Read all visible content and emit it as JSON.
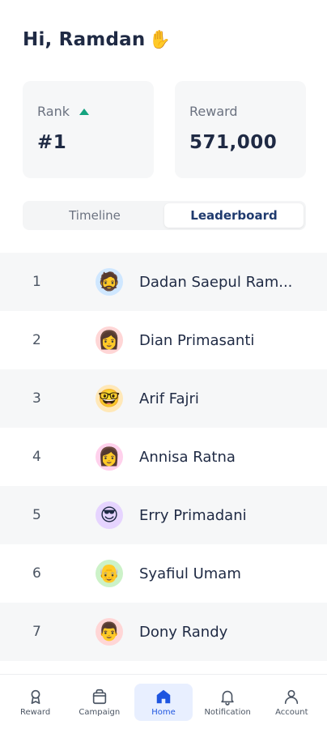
{
  "greeting": {
    "text": "Hi, Ramdan",
    "emoji": "✋"
  },
  "stats": {
    "rank": {
      "label": "Rank",
      "value": "#1",
      "trend": "up",
      "trend_color": "#14a37f"
    },
    "reward": {
      "label": "Reward",
      "value": "571,000"
    }
  },
  "tabs": [
    {
      "label": "Timeline",
      "active": false
    },
    {
      "label": "Leaderboard",
      "active": true
    }
  ],
  "leaderboard": [
    {
      "rank": "1",
      "name": "Dadan Saepul Ram...",
      "avatar": "🧔",
      "avatar_bg": "#cfe7ff"
    },
    {
      "rank": "2",
      "name": "Dian Primasanti",
      "avatar": "👩",
      "avatar_bg": "#ffd6d6"
    },
    {
      "rank": "3",
      "name": "Arif Fajri",
      "avatar": "🤓",
      "avatar_bg": "#ffe8b8"
    },
    {
      "rank": "4",
      "name": "Annisa Ratna",
      "avatar": "👩",
      "avatar_bg": "#ffd1ec"
    },
    {
      "rank": "5",
      "name": "Erry Primadani",
      "avatar": "😎",
      "avatar_bg": "#e6d4ff"
    },
    {
      "rank": "6",
      "name": "Syafiul Umam",
      "avatar": "👴",
      "avatar_bg": "#ccf2c8"
    },
    {
      "rank": "7",
      "name": "Dony Randy",
      "avatar": "👨",
      "avatar_bg": "#ffd6d6"
    }
  ],
  "nav": [
    {
      "label": "Reward",
      "icon": "medal-icon",
      "active": false
    },
    {
      "label": "Campaign",
      "icon": "bag-icon",
      "active": false
    },
    {
      "label": "Home",
      "icon": "home-icon",
      "active": true
    },
    {
      "label": "Notification",
      "icon": "bell-icon",
      "active": false
    },
    {
      "label": "Account",
      "icon": "user-icon",
      "active": false
    }
  ],
  "colors": {
    "accent": "#1e55e0",
    "accent_bg": "#e8efff",
    "text_dark": "#1f2a44",
    "row_shade": "#f6f7f8"
  }
}
